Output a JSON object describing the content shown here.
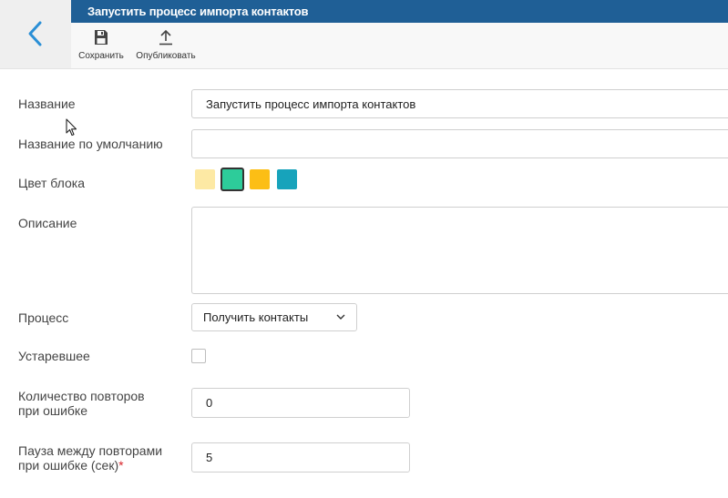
{
  "header": {
    "title": "Запустить процесс импорта контактов",
    "back_icon": "chevron-left-icon",
    "accent_color": "#1f5f96"
  },
  "toolbar": {
    "save_label": "Сохранить",
    "save_icon": "floppy-disk-icon",
    "publish_label": "Опубликовать",
    "publish_icon": "upload-arrow-icon"
  },
  "form": {
    "name": {
      "label": "Название",
      "value": "Запустить процесс импорта контактов"
    },
    "default_name": {
      "label": "Название по умолчанию",
      "value": ""
    },
    "block_color": {
      "label": "Цвет блока",
      "swatches": [
        "#fde9a4",
        "#2dcc9a",
        "#fcbe15",
        "#17a3bb"
      ],
      "selected_index": 1
    },
    "description": {
      "label": "Описание",
      "value": ""
    },
    "process": {
      "label": "Процесс",
      "selected": "Получить контакты"
    },
    "obsolete": {
      "label": "Устаревшее",
      "checked": false
    },
    "retry_count": {
      "label_line1": "Количество повторов",
      "label_line2": "при ошибке",
      "value": "0"
    },
    "retry_pause": {
      "label_line1": "Пауза между повторами",
      "label_line2": "при ошибке (сек)",
      "required_mark": "*",
      "value": "5"
    }
  }
}
